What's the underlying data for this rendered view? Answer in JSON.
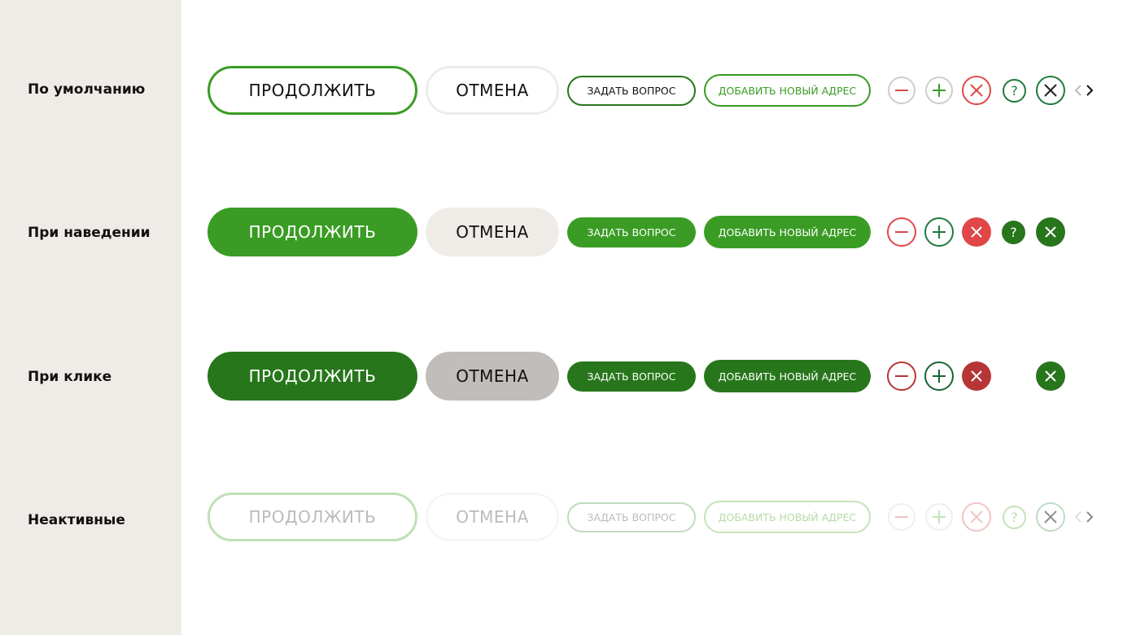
{
  "states": [
    {
      "id": "default",
      "label": "По умолчанию"
    },
    {
      "id": "hover",
      "label": "При наведении"
    },
    {
      "id": "click",
      "label": "При клике"
    },
    {
      "id": "disabled",
      "label": "Неактивные"
    }
  ],
  "buttons": {
    "primary_label": "ПРОДОЛЖИТЬ",
    "cancel_label": "ОТМЕНА",
    "ask_label": "ЗАДАТЬ ВОПРОС",
    "address_label": "ДОБАВИТЬ НОВЫЙ АДРЕС",
    "question_glyph": "?"
  },
  "colors": {
    "sidebar_bg": "#efece8",
    "green": "#3a9c24",
    "green_dark": "#27761b",
    "green_icon": "#1f7a3c",
    "red": "#e04848",
    "red_dark": "#b63535",
    "gray_border": "#cfcdcb",
    "cancel_hover": "#efece8",
    "cancel_active": "#c0bdba"
  }
}
